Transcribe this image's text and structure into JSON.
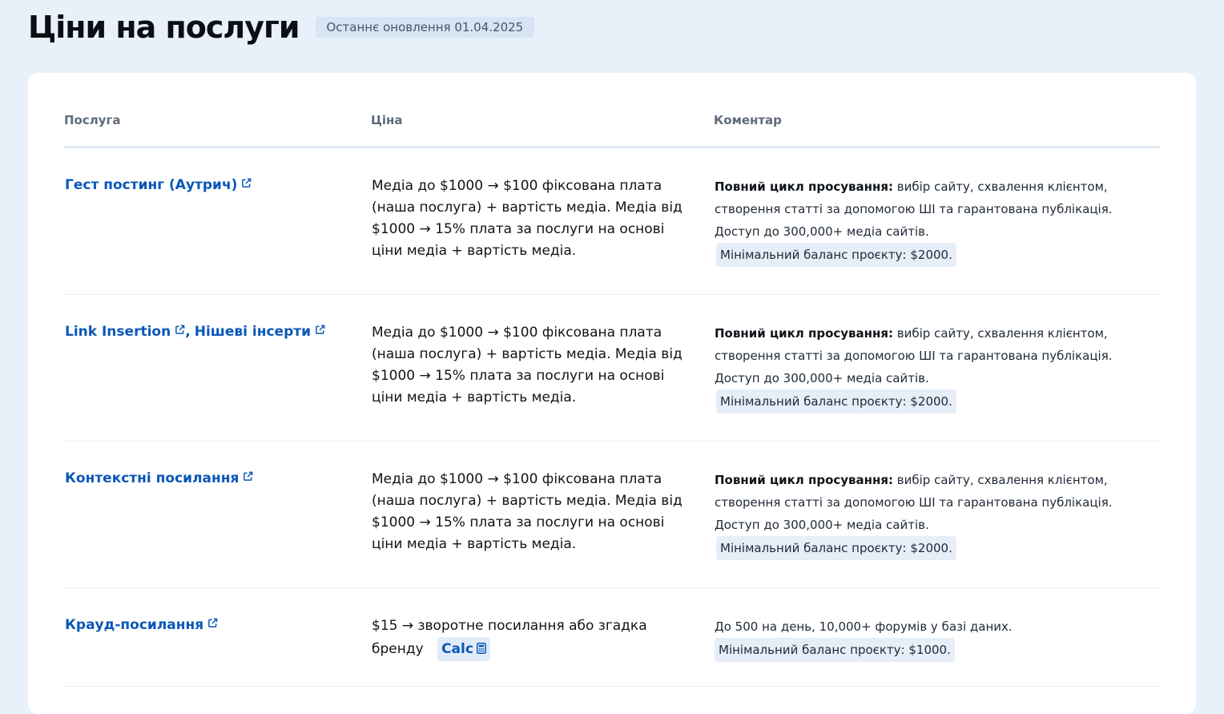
{
  "header": {
    "title": "Ціни на послуги",
    "updated": "Останнє оновлення 01.04.2025"
  },
  "table": {
    "columns": [
      "Послуга",
      "Ціна",
      "Коментар"
    ],
    "rows": [
      {
        "services": [
          "Гест постинг (Аутрич)"
        ],
        "price": "Медіа до $1000 → $100 фіксована плата (наша послуга) + вартість медіа. Медіа від $1000 → 15% плата за послуги на основі ціни медіа + вартість медіа.",
        "comment_bold": "Повний цикл просування:",
        "comment": " вибір сайту, схвалення клієнтом, створення статті за допомогою ШІ та гарантована публікація. Доступ до 300,000+ медіа сайтів.",
        "min_balance": "Мінімальний баланс проєкту: $2000."
      },
      {
        "services": [
          "Link Insertion",
          "Нішеві інсерти"
        ],
        "separator": ",",
        "price": "Медіа до $1000 → $100 фіксована плата (наша послуга) + вартість медіа. Медіа від $1000 → 15% плата за послуги на основі ціни медіа + вартість медіа.",
        "comment_bold": "Повний цикл просування:",
        "comment": " вибір сайту, схвалення клієнтом, створення статті за допомогою ШІ та гарантована публікація. Доступ до 300,000+ медіа сайтів.",
        "min_balance": "Мінімальний баланс проєкту: $2000."
      },
      {
        "services": [
          "Контекстні посилання"
        ],
        "price": "Медіа до $1000 → $100 фіксована плата (наша послуга) + вартість медіа. Медіа від $1000 → 15% плата за послуги на основі ціни медіа + вартість медіа.",
        "comment_bold": "Повний цикл просування:",
        "comment": " вибір сайту, схвалення клієнтом, створення статті за допомогою ШІ та гарантована публікація. Доступ до 300,000+ медіа сайтів.",
        "min_balance": "Мінімальний баланс проєкту: $2000."
      },
      {
        "services": [
          "Крауд-посилання"
        ],
        "price": "$15 → зворотне посилання або згадка бренду",
        "calc_label": "Calc",
        "comment": "До 500 на день, 10,000+ форумів у базі даних.",
        "min_balance": "Мінімальний баланс проєкту: $1000."
      }
    ]
  },
  "icons": {
    "external": "external-link-icon",
    "calculator": "calculator-icon"
  },
  "colors": {
    "background": "#e8f0fa",
    "link": "#0b57b8",
    "badge": "#e6eef8"
  }
}
